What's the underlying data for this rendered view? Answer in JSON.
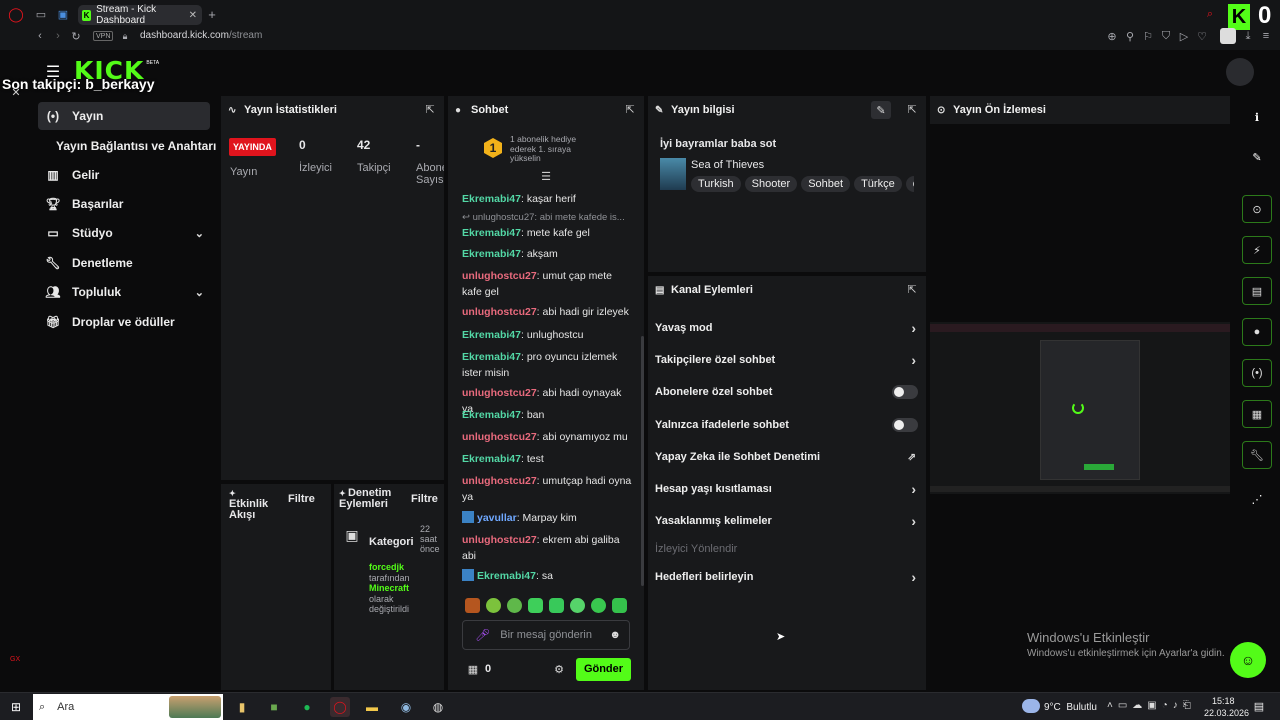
{
  "browser": {
    "tab_title": "Stream - Kick Dashboard",
    "new_tab": "+",
    "url_host": "dashboard.kick.com",
    "url_path": "/stream",
    "vpn": "VPN",
    "corner_badge": "0"
  },
  "overlay": {
    "last_follower": "Son takipçi: b_berkayy"
  },
  "header": {
    "logo": "KICK",
    "beta": "BETA"
  },
  "sidebar": {
    "items": [
      {
        "label": "Yayın",
        "icon": "stream-icon"
      },
      {
        "label": "Yayın Bağlantısı ve Anahtarı",
        "icon": ""
      },
      {
        "label": "Gelir",
        "icon": "chart-icon"
      },
      {
        "label": "Başarılar",
        "icon": "trophy-icon"
      },
      {
        "label": "Stüdyo",
        "icon": "studio-icon"
      },
      {
        "label": "Denetleme",
        "icon": "wrench-icon"
      },
      {
        "label": "Topluluk",
        "icon": "community-icon"
      },
      {
        "label": "Droplar ve ödüller",
        "icon": "gift-icon"
      }
    ]
  },
  "stats": {
    "title": "Yayın İstatistikleri",
    "live_badge": "YAYINDA",
    "live_label": "Yayın",
    "viewers_value": "0",
    "viewers_label": "İzleyici",
    "followers_value": "42",
    "followers_label": "Takipçi",
    "subs_value": "-",
    "subs_label": "Abone Sayısı"
  },
  "activity": {
    "title": "Etkinlik Akışı",
    "filter": "Filtre"
  },
  "mod_actions": {
    "title": "Denetim Eylemleri",
    "filter": "Filtre",
    "entry_title": "Kategori",
    "entry_time": "22 saat önce",
    "entry_user": "forcedjk",
    "entry_by": "tarafından",
    "entry_value": "Minecraft",
    "entry_as": "olarak değiştirildi"
  },
  "chat": {
    "title": "Sohbet",
    "gift_rank": "1",
    "gift_text": "1 abonelik hediye ederek 1. sıraya yükselin",
    "reply_preview": "unlughostcu27: abi mete kafede is...",
    "messages": [
      {
        "user": "Ekremabi47",
        "text": "kaşar herif",
        "color": "g"
      },
      {
        "user": "Ekremabi47",
        "text": "mete kafe gel",
        "color": "g"
      },
      {
        "user": "Ekremabi47",
        "text": "akşam",
        "color": "g"
      },
      {
        "user": "unlughostcu27",
        "text": "umut çap mete kafe gel",
        "color": "p"
      },
      {
        "user": "unlughostcu27",
        "text": "abi hadi gir izleyek",
        "color": "p"
      },
      {
        "user": "Ekremabi47",
        "text": "unlughostcu",
        "color": "g"
      },
      {
        "user": "Ekremabi47",
        "text": "pro oyuncu izlemek ister misin",
        "color": "g"
      },
      {
        "user": "unlughostcu27",
        "text": "abi hadi oynayak ya",
        "color": "p"
      },
      {
        "user": "Ekremabi47",
        "text": "ban",
        "color": "g"
      },
      {
        "user": "unlughostcu27",
        "text": "abi oynamıyoz mu",
        "color": "p"
      },
      {
        "user": "Ekremabi47",
        "text": "test",
        "color": "g"
      },
      {
        "user": "unlughostcu27",
        "text": "umutçap hadi oyna ya",
        "color": "p"
      },
      {
        "user": "yavullar",
        "text": "Marpay kim",
        "color": "b"
      },
      {
        "user": "unlughostcu27",
        "text": "ekrem abi galiba abi",
        "color": "p"
      },
      {
        "user": "Ekremabi47",
        "text": "sa",
        "color": "g"
      }
    ],
    "input_placeholder": "Bir mesaj gönderin",
    "points": "0",
    "send": "Gönder"
  },
  "info": {
    "title": "Yayın bilgisi",
    "stream_title": "İyi bayramlar baba sot",
    "game": "Sea of Thieves",
    "tags": [
      "Turkish",
      "Shooter",
      "Sohbet",
      "Türkçe",
      "c"
    ]
  },
  "channel_actions": {
    "title": "Kanal Eylemleri",
    "items": [
      {
        "label": "Yavaş mod",
        "kind": "arrow"
      },
      {
        "label": "Takipçilere özel sohbet",
        "kind": "arrow"
      },
      {
        "label": "Abonelere özel sohbet",
        "kind": "toggle"
      },
      {
        "label": "Yalnızca ifadelerle sohbet",
        "kind": "toggle"
      },
      {
        "label": "Yapay Zeka ile Sohbet Denetimi",
        "kind": "external"
      },
      {
        "label": "Hesap yaşı kısıtlaması",
        "kind": "arrow"
      },
      {
        "label": "Yasaklanmış kelimeler",
        "kind": "arrow"
      },
      {
        "label": "İzleyici Yönlendir",
        "kind": "disabled"
      },
      {
        "label": "Hedefleri belirleyin",
        "kind": "arrow"
      }
    ]
  },
  "preview": {
    "title": "Yayın Ön İzlemesi"
  },
  "windows": {
    "activate_title": "Windows'u Etkinleştir",
    "activate_sub": "Windows'u etkinleştirmek için Ayarlar'a gidin."
  },
  "taskbar": {
    "search": "Ara",
    "weather": "9°C  Bulutlu",
    "time": "15:18",
    "date": "22.03.2026"
  },
  "colors": {
    "kick_green": "#53fc18",
    "live_red": "#e0141d"
  }
}
